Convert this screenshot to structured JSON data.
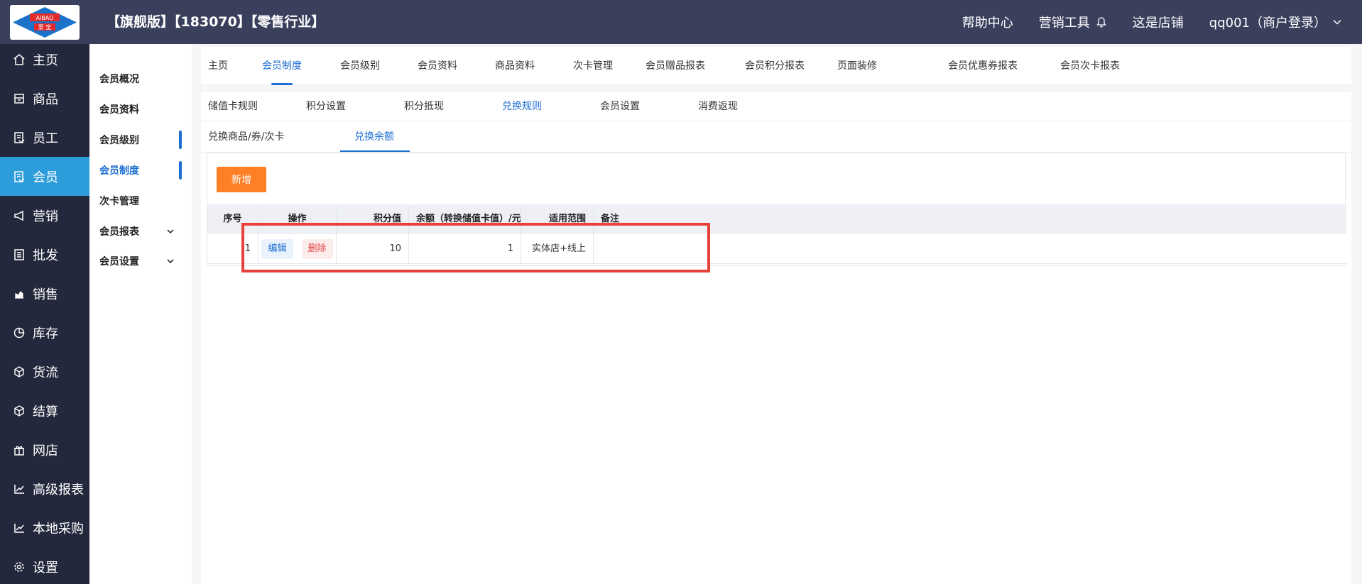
{
  "header": {
    "logo_text_top": "AIBAO",
    "logo_text_bottom": "爱 宝",
    "edition": "【旗舰版】【183070】【零售行业】",
    "help": "帮助中心",
    "marketing_tools": "营销工具",
    "shop": "这是店铺",
    "user": "qq001（商户登录）"
  },
  "sidebar": {
    "items": [
      {
        "label": "主页",
        "icon": "home-icon"
      },
      {
        "label": "商品",
        "icon": "goods-icon"
      },
      {
        "label": "员工",
        "icon": "staff-icon"
      },
      {
        "label": "会员",
        "icon": "member-icon"
      },
      {
        "label": "营销",
        "icon": "megaphone-icon"
      },
      {
        "label": "批发",
        "icon": "wholesale-icon"
      },
      {
        "label": "销售",
        "icon": "sales-chart-icon"
      },
      {
        "label": "库存",
        "icon": "pie-chart-icon"
      },
      {
        "label": "货流",
        "icon": "logistics-icon"
      },
      {
        "label": "结算",
        "icon": "settle-icon"
      },
      {
        "label": "网店",
        "icon": "gift-icon"
      },
      {
        "label": "高级报表",
        "icon": "line-chart-icon"
      },
      {
        "label": "本地采购",
        "icon": "line-chart-icon"
      },
      {
        "label": "设置",
        "icon": "gear-icon"
      }
    ],
    "active": "会员"
  },
  "subbar": {
    "items": [
      {
        "label": "会员概况"
      },
      {
        "label": "会员资料"
      },
      {
        "label": "会员级别"
      },
      {
        "label": "会员制度"
      },
      {
        "label": "次卡管理"
      },
      {
        "label": "会员报表"
      },
      {
        "label": "会员设置"
      }
    ],
    "active": "会员制度"
  },
  "tabs_top": [
    "主页",
    "会员制度",
    "会员级别",
    "会员资料",
    "商品资料",
    "次卡管理",
    "会员赠品报表",
    "会员积分报表",
    "页面装修",
    "会员优惠券报表",
    "会员次卡报表"
  ],
  "tabs_second": [
    "储值卡规则",
    "积分设置",
    "积分抵现",
    "兑换规则",
    "会员设置",
    "消费返现"
  ],
  "tabs_third": [
    "兑换商品/券/次卡",
    "兑换余额"
  ],
  "toolbar": {
    "add_label": "新增"
  },
  "table": {
    "headers": [
      "序号",
      "操作",
      "积分值",
      "余额（转换储值卡值）/元",
      "适用范围",
      "备注"
    ],
    "rows": [
      {
        "index": "1",
        "edit": "编辑",
        "delete": "删除",
        "points": "10",
        "balance": "1",
        "scope": "实体店+线上",
        "remark": ""
      }
    ]
  },
  "colors": {
    "topbar": "#3a3f5c",
    "sidebar": "#23283c",
    "sidebar_active": "#2d9cdb",
    "accent": "#1f6fd1",
    "add_button": "#ff7f27",
    "highlight": "#e8413a"
  }
}
